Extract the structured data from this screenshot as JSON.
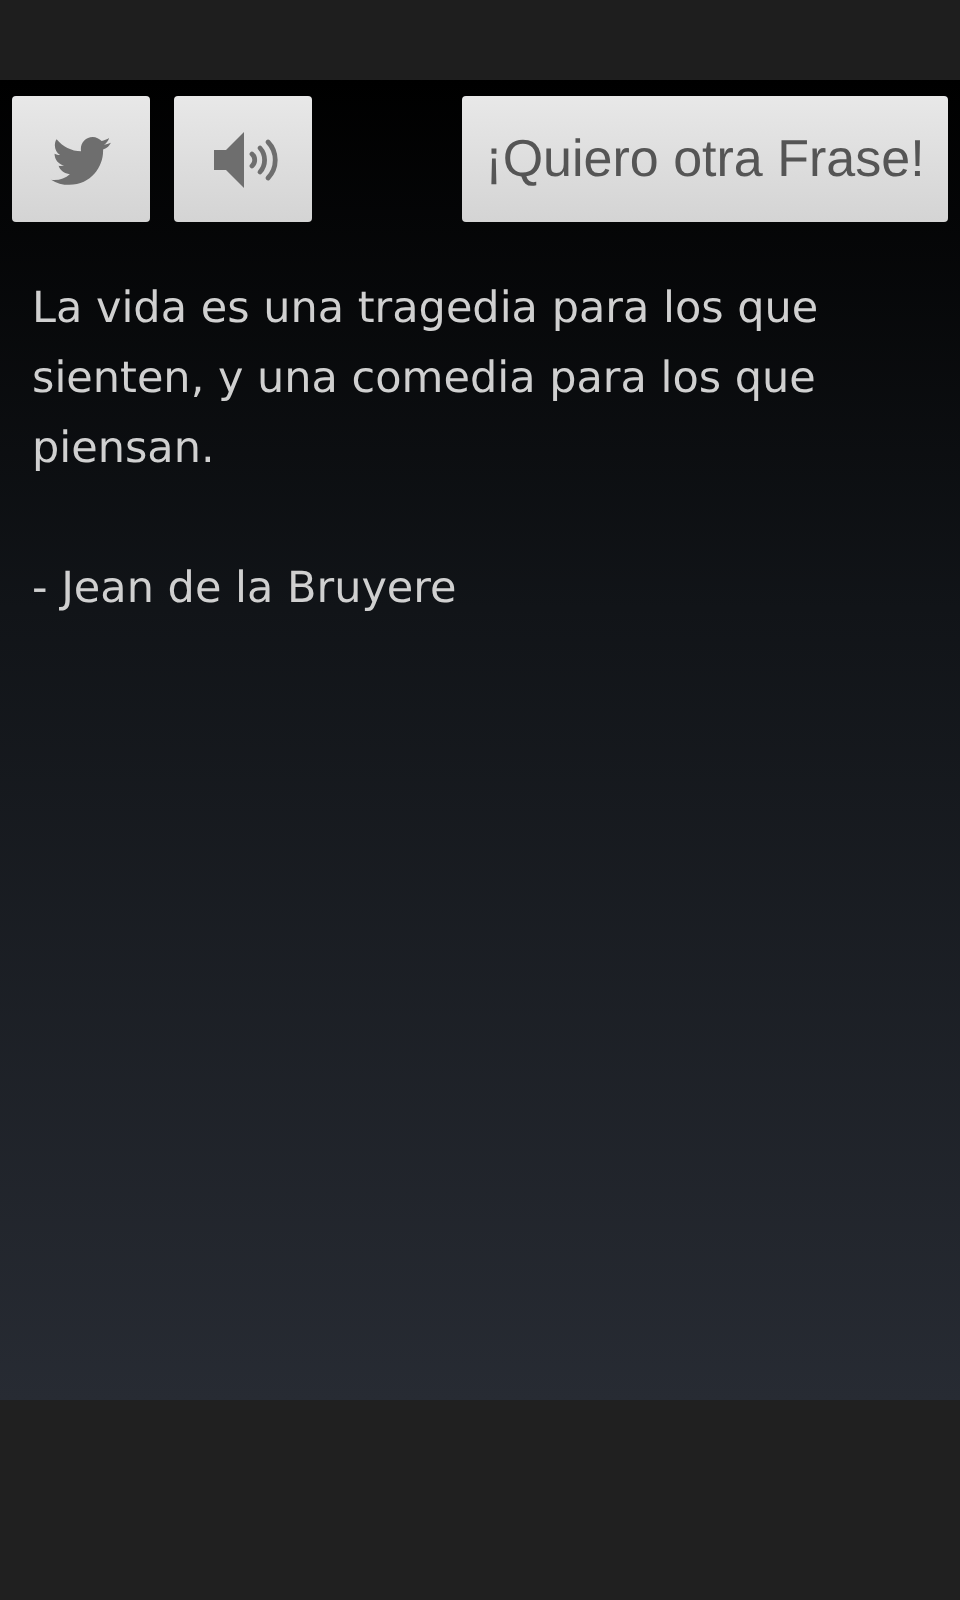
{
  "toolbar": {
    "next_button": "¡Quiero otra Frase!"
  },
  "quote": {
    "text": "La vida es una tragedia para los que sienten, y una comedia para los que piensan.",
    "author": "- Jean de la Bruyere"
  }
}
